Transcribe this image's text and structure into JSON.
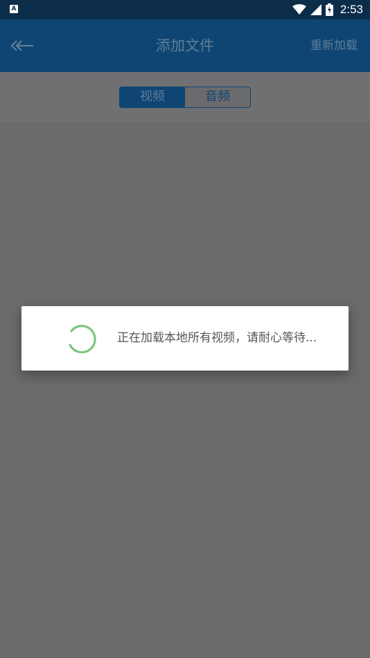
{
  "status_bar": {
    "notification_icon": "A",
    "time": "2:53",
    "icons": [
      "wifi-icon",
      "signal-icon",
      "battery-charging-icon"
    ]
  },
  "app_bar": {
    "back_icon": "back-arrow-icon",
    "title": "添加文件",
    "reload_label": "重新加载"
  },
  "segmented": {
    "tabs": [
      {
        "label": "视频",
        "selected": true
      },
      {
        "label": "音频",
        "selected": false
      }
    ]
  },
  "dialog": {
    "icon": "loading-spinner-icon",
    "message": "正在加载本地所有视频，请耐心等待..."
  },
  "colors": {
    "status_bar": "#0c2d4a",
    "app_bar": "#0e4573",
    "overlay_background": "#6b6b6d",
    "spinner": "#7cc67e",
    "dialog_text": "#555555"
  }
}
